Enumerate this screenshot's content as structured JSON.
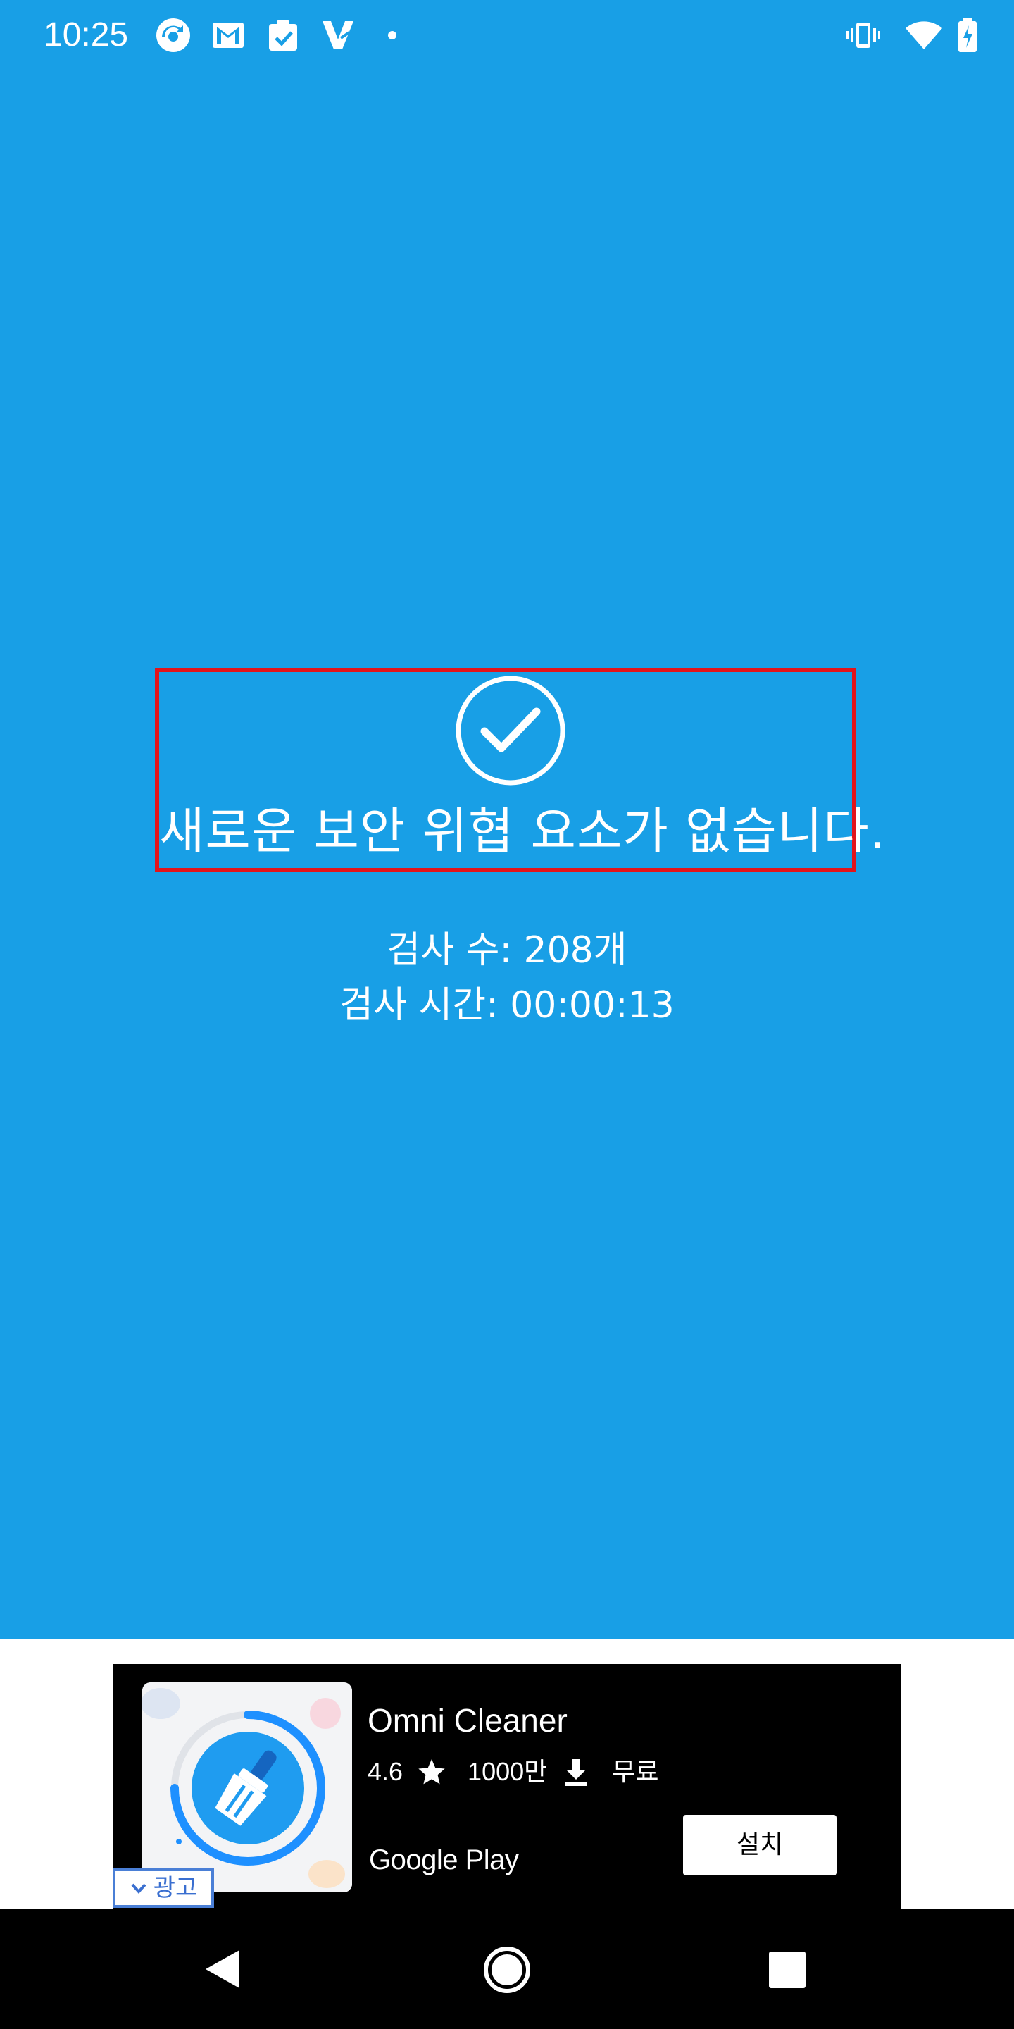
{
  "status_bar": {
    "time": "10:25",
    "left_icons": [
      "sync-app-icon",
      "gmail-icon",
      "clipboard-app-icon",
      "v-app-icon",
      "dot-icon"
    ],
    "right_icons": [
      "vibrate-icon",
      "wifi-icon",
      "battery-charging-icon"
    ]
  },
  "result": {
    "icon": "check-circle-icon",
    "title": "새로운 보안 위협 요소가 없습니다.",
    "scan_count": "검사 수: 208개",
    "scan_time": "검사 시간: 00:00:13"
  },
  "ad": {
    "app_name": "Omni Cleaner",
    "rating": "4.6",
    "downloads": "1000만",
    "price": "무료",
    "store": "Google Play",
    "install_label": "설치",
    "ad_label": "광고"
  },
  "nav_bar": {
    "buttons": [
      "back-icon",
      "home-icon",
      "recents-icon"
    ]
  },
  "colors": {
    "background": "#189fe6",
    "highlight_border": "#e2141b",
    "ad_background": "#000000",
    "ad_label": "#3a6fd0"
  }
}
